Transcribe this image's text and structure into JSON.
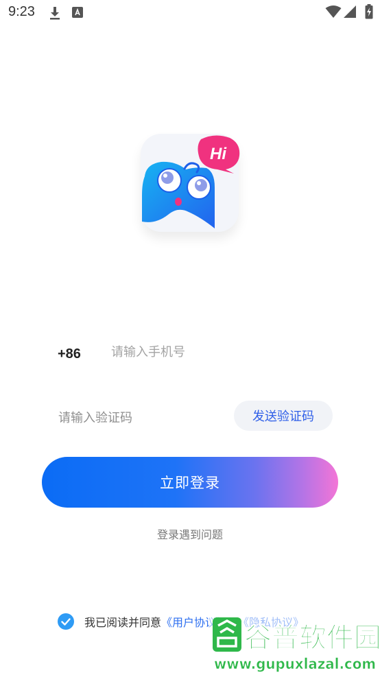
{
  "status_bar": {
    "time": "9:23",
    "icons": [
      "download-icon",
      "text-a-icon",
      "wifi-icon",
      "signal-icon",
      "battery-charging-icon"
    ]
  },
  "logo": {
    "badge_text": "Hi",
    "colors": {
      "tile": "#f3f5fa",
      "creature": "#1f86f2",
      "badge": "#f0327f"
    }
  },
  "form": {
    "country_code": "+86",
    "phone_placeholder": "请输入手机号",
    "code_placeholder": "请输入验证码",
    "send_code_label": "发送验证码",
    "login_label": "立即登录",
    "login_problem": "登录遇到问题"
  },
  "agreement": {
    "checked": true,
    "prefix": "我已阅读并同意",
    "user_agreement": "《用户协议》",
    "and": "及",
    "privacy_agreement": "《隐私协议》"
  },
  "watermark": {
    "title": "谷普软件园",
    "url": "www.gupuxlazal.com"
  },
  "colors": {
    "accent_blue": "#2d6ff0",
    "gradient_start": "#0b6cf5",
    "gradient_end": "#f375d6",
    "check_blue": "#2e9bf5"
  }
}
